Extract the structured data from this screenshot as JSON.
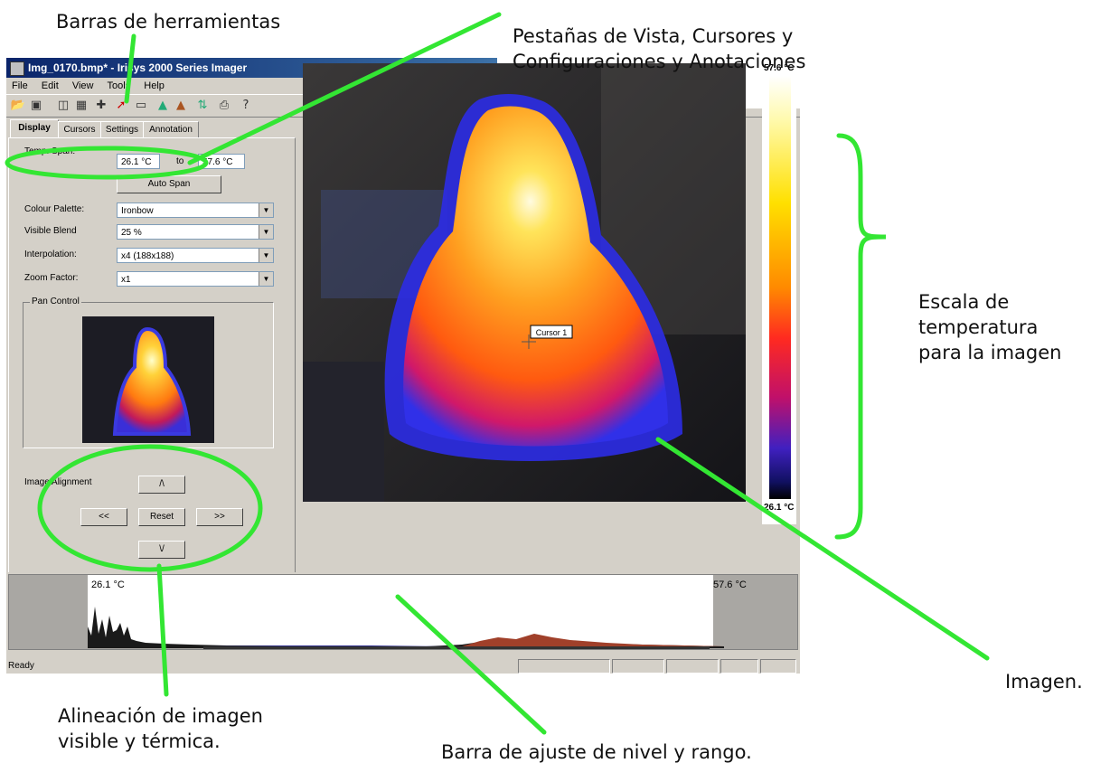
{
  "window": {
    "title": "Img_0170.bmp* - Irisys 2000 Series Imager",
    "menu": [
      "File",
      "Edit",
      "View",
      "Tools",
      "Help"
    ]
  },
  "toolbar": {
    "icons": [
      "open-icon",
      "save-icon",
      "properties-icon",
      "export-icon",
      "cursor-add-icon",
      "pin-icon",
      "rectangle-icon",
      "palette-icon",
      "compare-icon",
      "crosshair-icon",
      "print-icon",
      "help-icon"
    ]
  },
  "tabs": [
    "Display",
    "Cursors",
    "Settings",
    "Annotation"
  ],
  "display": {
    "temp_span_label": "Temp. Span:",
    "temp_span_from": "26.1 °C",
    "temp_span_to_label": "to",
    "temp_span_to": "57.6 °C",
    "auto_span_label": "Auto Span",
    "colour_palette_label": "Colour Palette:",
    "colour_palette_value": "Ironbow",
    "visible_blend_label": "Visible Blend",
    "visible_blend_value": "25 %",
    "interpolation_label": "Interpolation:",
    "interpolation_value": "x4 (188x188)",
    "zoom_label": "Zoom Factor:",
    "zoom_value": "x1",
    "pan_control_label": "Pan Control",
    "alignment_label": "Image Alignment",
    "up_button": "/\\",
    "left_button": "<<",
    "reset_button": "Reset",
    "right_button": ">>",
    "down_button": "\\/"
  },
  "image": {
    "cursor_label": "Cursor 1"
  },
  "scale": {
    "max": "57.6 °C",
    "min": "26.1 °C"
  },
  "histogram": {
    "low_label": "26.1 °C",
    "high_label": "57.6 °C"
  },
  "status": {
    "text": "Ready"
  },
  "callouts": {
    "toolbars": "Barras de herramientas",
    "tabs_line1": "Pestañas de Vista, Cursores y",
    "tabs_line2": "Configuraciones y Anotaciones",
    "scale_line1": "Escala de",
    "scale_line2": "temperatura",
    "scale_line3": "para la imagen",
    "image": "Imagen.",
    "align_line1": "Alineación de imagen",
    "align_line2": "visible y térmica.",
    "range": "Barra de ajuste de nivel y rango."
  },
  "colors": {
    "annotation": "#33e633",
    "window_bg": "#d4d0c8",
    "title_bar": "#0a246a"
  }
}
